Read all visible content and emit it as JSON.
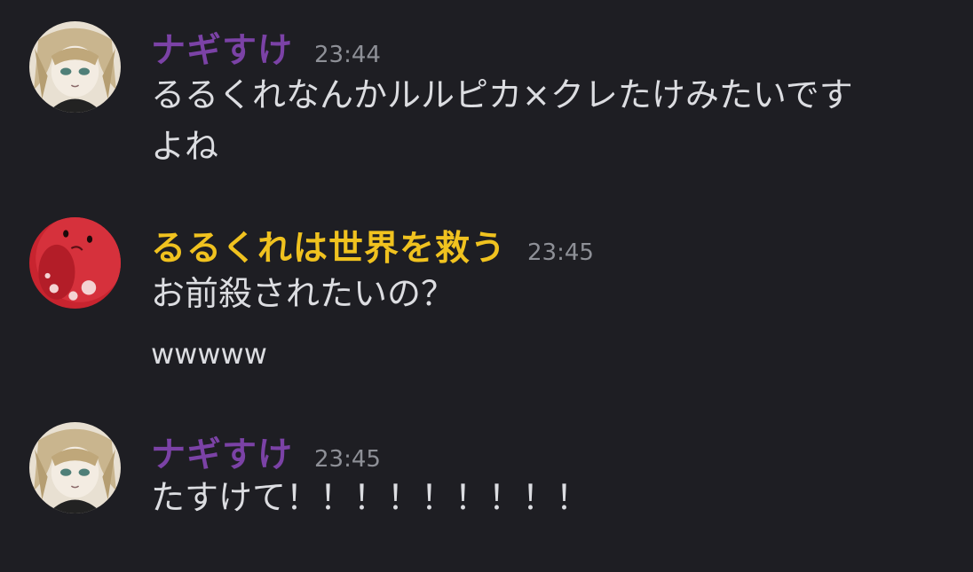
{
  "colors": {
    "background": "#1e1e23",
    "text": "#dcdde1",
    "timestamp": "#8e9097",
    "user_purple": "#7b42a6",
    "user_yellow": "#f0c21f"
  },
  "messages": [
    {
      "username": "ナギすけ",
      "name_color": "#7b42a6",
      "avatar_icon": "anime-girl-avatar",
      "timestamp": "23:44",
      "lines": [
        "るるくれなんかルルピカ×クレたけみたいです",
        "よね"
      ]
    },
    {
      "username": "るるくれは世界を救う",
      "name_color": "#f0c21f",
      "avatar_icon": "red-ball-creature-avatar",
      "timestamp": "23:45",
      "lines": [
        "お前殺されたいの？",
        "wwwww"
      ]
    },
    {
      "username": "ナギすけ",
      "name_color": "#7b42a6",
      "avatar_icon": "anime-girl-avatar",
      "timestamp": "23:45",
      "lines": [
        "たすけて！！！！！！！！！"
      ]
    }
  ]
}
